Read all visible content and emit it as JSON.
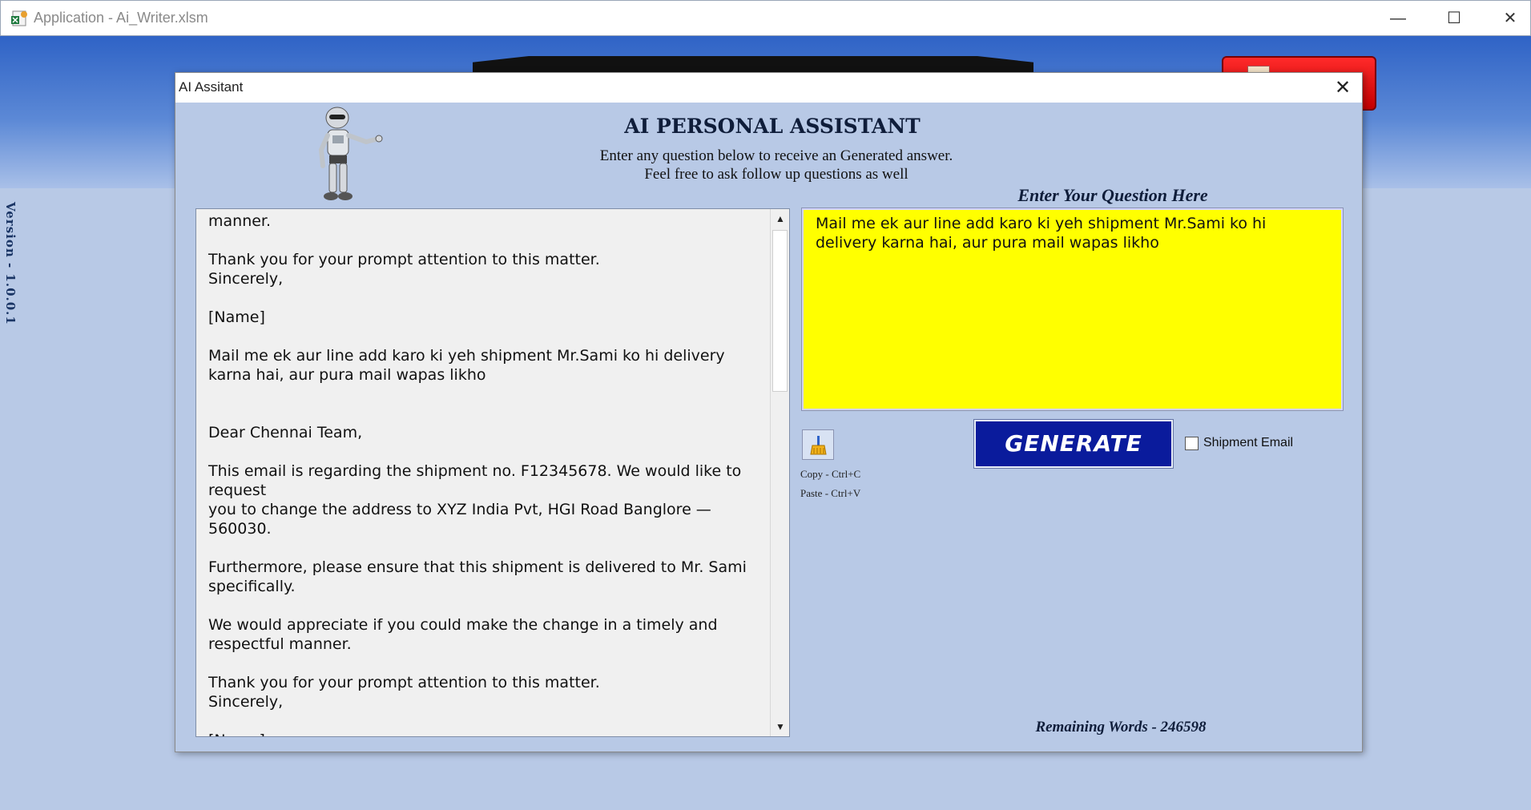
{
  "app": {
    "window_title": "Application - Ai_Writer.xlsm",
    "minimize": "—",
    "maximize": "☐",
    "close": "✕"
  },
  "background": {
    "version": "Version - 1.0.0.1"
  },
  "dialog": {
    "title": "AI Assitant",
    "close": "✕",
    "heading": "AI PERSONAL ASSISTANT",
    "subtext_line1": "Enter any question below to receive an Generated answer.",
    "subtext_line2": "Feel free to ask follow up questions as well",
    "question_label": "Enter Your Question Here",
    "answer_text": "manner.\n\nThank you for your prompt attention to this matter.\nSincerely,\n\n[Name]\n\nMail me ek aur line add karo ki yeh shipment Mr.Sami ko hi delivery karna hai, aur pura mail wapas likho\n\n\nDear Chennai Team,\n\nThis email is regarding the shipment no. F12345678. We would like to request\nyou to change the address to XYZ India Pvt, HGI Road Banglore — 560030.\n\nFurthermore, please ensure that this shipment is delivered to Mr. Sami specifically.\n\nWe would appreciate if you could make the change in a timely and respectful manner.\n\nThank you for your prompt attention to this matter.\nSincerely,\n\n[Name]",
    "question_text": "Mail me ek aur line add karo ki yeh shipment Mr.Sami ko hi delivery karna hai, aur pura mail wapas likho",
    "copy_hint": "Copy - Ctrl+C",
    "paste_hint": "Paste - Ctrl+V",
    "generate_label": "GENERATE",
    "shipment_email_label": "Shipment Email",
    "shipment_email_checked": false,
    "remaining_words": "Remaining Words - 246598",
    "scroll_up": "▲",
    "scroll_down": "▼"
  },
  "colors": {
    "dialog_bg": "#b8c9e6",
    "question_bg": "#ffff00",
    "generate_bg": "#0a1b9c",
    "heading_text": "#0f1d3a"
  },
  "icons": {
    "app": "excel-file-icon",
    "clear": "broom-icon",
    "robot": "robot-illustration"
  }
}
